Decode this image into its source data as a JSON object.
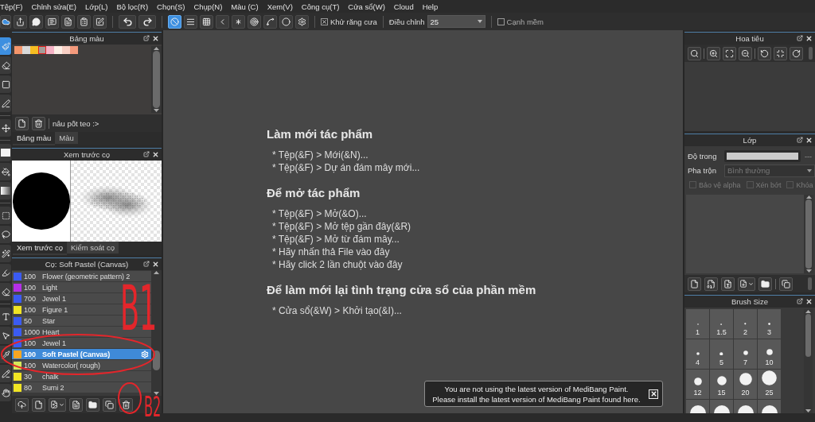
{
  "menu": [
    "Tệp(F)",
    "Chỉnh sửa(E)",
    "Lớp(L)",
    "Bộ lọc(R)",
    "Chọn(S)",
    "Chụp(N)",
    "Màu (C)",
    "Xem(V)",
    "Công cụ(T)",
    "Cửa sổ(W)",
    "Cloud",
    "Help"
  ],
  "toolbar": {
    "snap_modes": [
      {
        "kind": "off",
        "selected": true
      },
      {
        "kind": "parallel",
        "selected": false
      },
      {
        "kind": "grid",
        "selected": false
      },
      {
        "kind": "perspective",
        "selected": false
      },
      {
        "kind": "radial",
        "selected": false
      },
      {
        "kind": "concentric",
        "selected": false
      },
      {
        "kind": "curve",
        "selected": false
      },
      {
        "kind": "circle",
        "selected": false
      },
      {
        "kind": "settings",
        "selected": false
      }
    ],
    "antialias": {
      "label": "Khử răng cưa",
      "checked": true
    },
    "correction": {
      "label": "Điều chỉnh",
      "value": "25"
    },
    "soft_edge": {
      "label": "Cạnh mềm",
      "checked": false
    }
  },
  "tools": [
    {
      "kind": "brush",
      "selected": true
    },
    {
      "kind": "eraser",
      "selected": false
    },
    {
      "kind": "shape",
      "selected": false
    },
    {
      "kind": "pen",
      "selected": false
    },
    {
      "kind": "move",
      "selected": false
    },
    {
      "kind": "fill",
      "selected": false
    },
    {
      "kind": "bucket",
      "selected": false
    },
    {
      "kind": "gradient",
      "selected": false
    },
    {
      "kind": "select",
      "selected": false
    },
    {
      "kind": "lasso",
      "selected": false
    },
    {
      "kind": "wand",
      "selected": false
    },
    {
      "kind": "selectpen",
      "selected": false
    },
    {
      "kind": "selecteraser",
      "selected": false
    },
    {
      "kind": "text",
      "selected": false
    },
    {
      "kind": "operation",
      "selected": false
    },
    {
      "kind": "eyedropper",
      "selected": false
    },
    {
      "kind": "divide",
      "selected": false
    },
    {
      "kind": "hand",
      "selected": false
    }
  ],
  "palette": {
    "title": "Bảng màu",
    "swatches": [
      {
        "color": "#f4956a",
        "selected": false
      },
      {
        "color": "#d9d9d9",
        "selected": false
      },
      {
        "color": "#f6bd22",
        "selected": false
      },
      {
        "color": "#a49c98",
        "selected": true
      },
      {
        "color": "#f6b3c6",
        "selected": false
      },
      {
        "color": "#fdefe6",
        "selected": false
      },
      {
        "color": "#f8cfc4",
        "selected": false
      },
      {
        "color": "#f49a7c",
        "selected": false
      }
    ],
    "palette_name": "nâu pốt teo :>",
    "tabs": [
      {
        "label": "Bảng màu",
        "selected": true
      },
      {
        "label": "Màu",
        "selected": false
      }
    ]
  },
  "preview": {
    "title": "Xem trước cọ",
    "tabs": [
      {
        "label": "Xem trước cọ",
        "selected": true
      },
      {
        "label": "Kiểm soát cọ",
        "selected": false
      }
    ]
  },
  "brushes": {
    "title": "Cọ: Soft Pastel (Canvas)",
    "items": [
      {
        "color": "#3b5bf2",
        "size": "100",
        "name": "Flower (geometric pattern) 2",
        "selected": false
      },
      {
        "color": "#b52fe8",
        "size": "100",
        "name": "Light",
        "selected": false
      },
      {
        "color": "#3b5bf2",
        "size": "700",
        "name": "Jewel 1",
        "selected": false
      },
      {
        "color": "#f0e424",
        "size": "100",
        "name": "Figure 1",
        "selected": false
      },
      {
        "color": "#3b5bf2",
        "size": "50",
        "name": "Star",
        "selected": false
      },
      {
        "color": "#3b5bf2",
        "size": "1000",
        "name": "Heart",
        "selected": false
      },
      {
        "color": "#3b5bf2",
        "size": "100",
        "name": "Jewel 1",
        "selected": false
      },
      {
        "color": "#f5a623",
        "size": "100",
        "name": "Soft Pastel (Canvas)",
        "selected": true
      },
      {
        "color": "#d6e85a",
        "size": "100",
        "name": "Watercolor( rough)",
        "selected": false
      },
      {
        "color": "#f0e424",
        "size": "30",
        "name": "chalk",
        "selected": false
      },
      {
        "color": "#f0e424",
        "size": "80",
        "name": "Sumi 2",
        "selected": false
      }
    ]
  },
  "help": {
    "sections": [
      {
        "heading": "Làm mới tác phẩm",
        "lines": [
          "* Tệp(&F) > Mới(&N)...",
          "* Tệp(&F) > Dự án đám mây mới..."
        ]
      },
      {
        "heading": "Để mở tác phẩm",
        "lines": [
          "* Tệp(&F) > Mở(&O)...",
          "* Tệp(&F) > Mở tệp gần đây(&R)",
          "* Tệp(&F) > Mở từ đám mây...",
          "* Hãy nhấn thả File vào đây",
          "* Hãy click 2 lần chuột vào đây"
        ]
      },
      {
        "heading": "Để làm mới lại tình trạng cửa sổ của phần mềm",
        "lines": [
          "* Cửa sổ(&W) > Khởi tạo(&I)..."
        ]
      }
    ]
  },
  "notification": {
    "lines": [
      "You are not using the latest version of MediBang Paint.",
      "Please install the latest version of MediBang Paint found here."
    ]
  },
  "navigator": {
    "title": "Hoa tiêu"
  },
  "layers": {
    "title": "Lớp",
    "opacity": {
      "label": "Độ trong",
      "level": 1,
      "reading": "---"
    },
    "blend": {
      "label": "Pha trộn",
      "value": "Bình thường",
      "disabled": true
    },
    "options": [
      {
        "label": "Bảo vệ alpha",
        "checked": false,
        "disabled": true
      },
      {
        "label": "Xén bớt",
        "checked": false,
        "disabled": true
      },
      {
        "label": "Khóa",
        "checked": false,
        "disabled": true
      }
    ]
  },
  "brush_size": {
    "title": "Brush Size",
    "sizes": [
      "1",
      "1.5",
      "2",
      "3",
      "4",
      "5",
      "7",
      "10",
      "12",
      "15",
      "20",
      "25"
    ]
  },
  "annotations": [
    {
      "kind": "label",
      "text": "B1"
    },
    {
      "kind": "ellipse"
    },
    {
      "kind": "label",
      "text": "B2"
    },
    {
      "kind": "ring"
    }
  ]
}
